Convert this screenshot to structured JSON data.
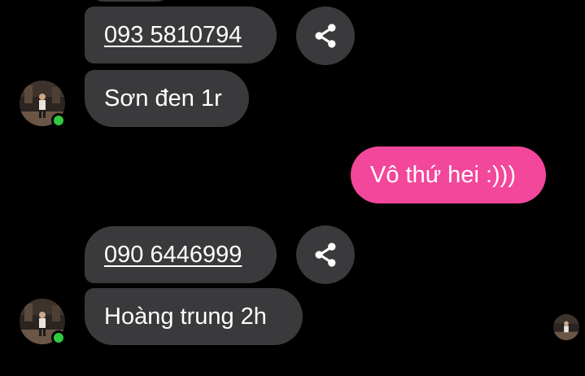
{
  "colors": {
    "background": "#000000",
    "incoming_bubble": "#3a3a3c",
    "outgoing_bubble": "#f2479a",
    "online_status": "#31c93f",
    "text": "#ffffff"
  },
  "messages": [
    {
      "type": "incoming",
      "text": "093 5810794",
      "is_phone": true
    },
    {
      "type": "incoming",
      "text": "Sơn đen 1r"
    },
    {
      "type": "outgoing",
      "text": "Vô thứ hei :)))"
    },
    {
      "type": "incoming",
      "text": "090 6446999",
      "is_phone": true
    },
    {
      "type": "incoming",
      "text": "Hoàng trung 2h"
    }
  ],
  "icons": {
    "share": "share-icon",
    "avatar": "contact-avatar",
    "online": "online-status-dot",
    "seen": "seen-receipt-avatar"
  }
}
